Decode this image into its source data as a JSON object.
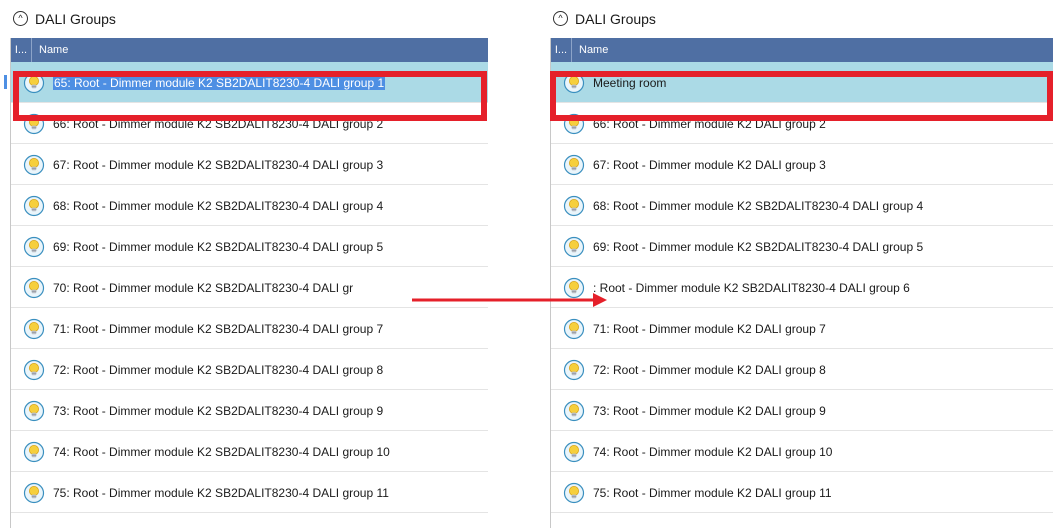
{
  "left_panel": {
    "title": "DALI Groups",
    "columns": {
      "icon": "I...",
      "name": "Name"
    },
    "rows": [
      {
        "label": "65: Root - Dimmer module K2 SB2DALIT8230-4 DALI group 1",
        "selected": true
      },
      {
        "label": "66: Root - Dimmer module K2 SB2DALIT8230-4 DALI group 2"
      },
      {
        "label": "67: Root - Dimmer module K2 SB2DALIT8230-4 DALI group 3"
      },
      {
        "label": "68: Root - Dimmer module K2 SB2DALIT8230-4 DALI group 4"
      },
      {
        "label": "69: Root - Dimmer module K2 SB2DALIT8230-4 DALI group 5"
      },
      {
        "label": "70: Root - Dimmer module K2 SB2DALIT8230-4 DALI gr"
      },
      {
        "label": "71: Root - Dimmer module K2 SB2DALIT8230-4 DALI group 7"
      },
      {
        "label": "72: Root - Dimmer module K2 SB2DALIT8230-4 DALI group 8"
      },
      {
        "label": "73: Root - Dimmer module K2 SB2DALIT8230-4 DALI group 9"
      },
      {
        "label": "74: Root - Dimmer module K2 SB2DALIT8230-4 DALI group 10"
      },
      {
        "label": "75: Root - Dimmer module K2 SB2DALIT8230-4 DALI group 11"
      }
    ]
  },
  "right_panel": {
    "title": "DALI Groups",
    "columns": {
      "icon": "I...",
      "name": "Name"
    },
    "rows": [
      {
        "label": "Meeting room",
        "selected": true
      },
      {
        "label": "66: Root - Dimmer module K2 DALI group 2"
      },
      {
        "label": "67: Root - Dimmer module K2 DALI group 3"
      },
      {
        "label": "68: Root - Dimmer module K2 SB2DALIT8230-4 DALI group 4"
      },
      {
        "label": "69: Root - Dimmer module K2 SB2DALIT8230-4 DALI group 5"
      },
      {
        "label": ": Root - Dimmer module K2 SB2DALIT8230-4 DALI group 6"
      },
      {
        "label": "71: Root - Dimmer module K2 DALI group 7"
      },
      {
        "label": "72: Root - Dimmer module K2 DALI group 8"
      },
      {
        "label": "73: Root - Dimmer module K2 DALI group 9"
      },
      {
        "label": "74: Root - Dimmer module K2 DALI group 10"
      },
      {
        "label": "75: Root - Dimmer module K2 DALI group 11"
      }
    ]
  },
  "icons": {
    "row": "light-bulb-icon",
    "collapse": "chevron-up-icon"
  },
  "colors": {
    "header_bar": "#4f6fa3",
    "selected_row": "#abdae6",
    "text_highlight": "#4e8fe3",
    "annotation_red": "#e5202a"
  }
}
